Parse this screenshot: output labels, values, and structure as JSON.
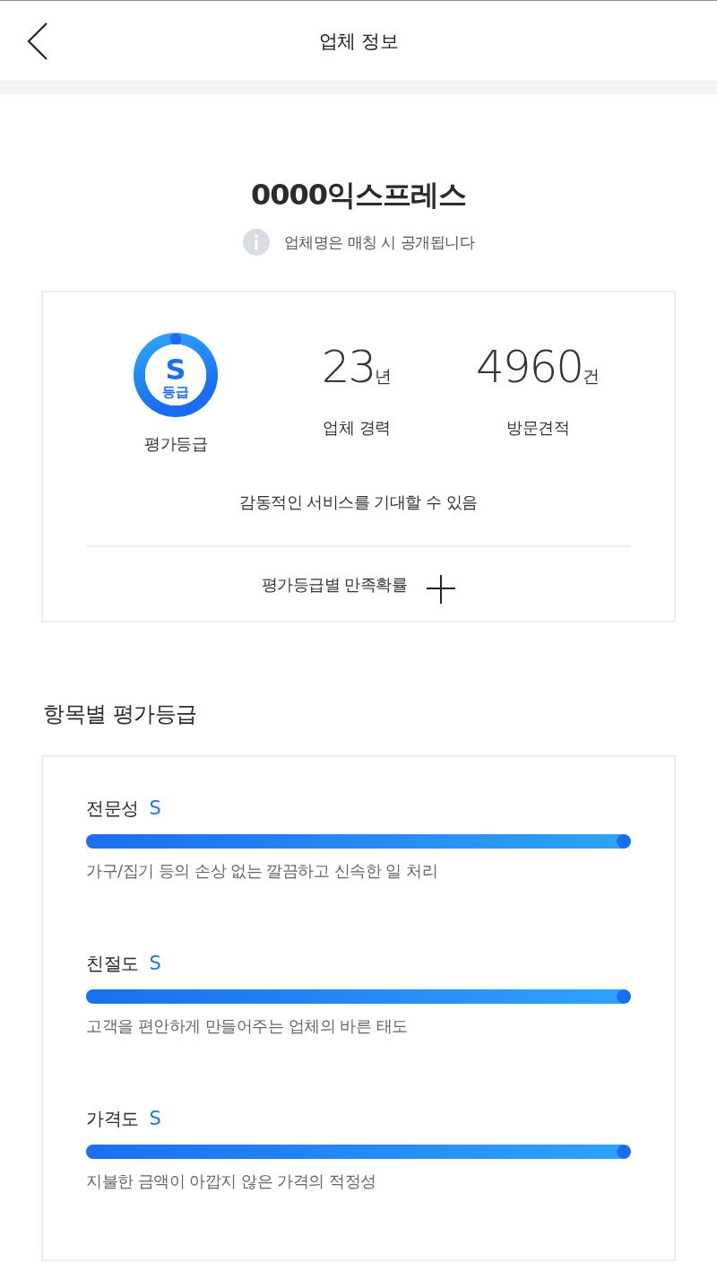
{
  "header": {
    "title": "업체 정보"
  },
  "company": {
    "name": "0000익스프레스",
    "notice": "업체명은 매칭 시 공개됩니다"
  },
  "summary": {
    "grade": {
      "letter": "S",
      "unit": "등급",
      "label": "평가등급"
    },
    "stats": [
      {
        "value": "23",
        "unit": "년",
        "label": "업체 경력"
      },
      {
        "value": "4960",
        "unit": "건",
        "label": "방문견적"
      }
    ],
    "message": "감동적인 서비스를 기대할 수 있음",
    "toggle": {
      "label": "평가등급별 만족확률",
      "expanded": false
    }
  },
  "ratings": {
    "title": "항목별 평가등급",
    "items": [
      {
        "name": "전문성",
        "grade": "S",
        "level": 1,
        "description": "가구/집기 등의 손상 없는 깔끔하고 신속한 일 처리"
      },
      {
        "name": "친절도",
        "grade": "S",
        "level": 1,
        "description": "고객을 편안하게 만들어주는 업체의 바른 태도"
      },
      {
        "name": "가격도",
        "grade": "S",
        "level": 1,
        "description": "지불한 금액이 아깝지 않은 가격의 적정성"
      }
    ]
  }
}
